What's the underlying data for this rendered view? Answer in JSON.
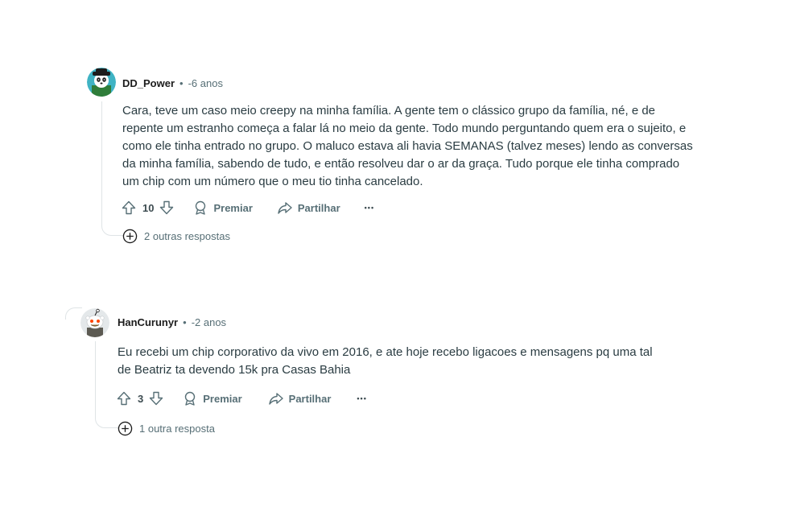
{
  "comments": [
    {
      "username": "DD_Power",
      "separator": "•",
      "time": "-6 anos",
      "avatar_icon": "panda-snoo-avatar",
      "text": "Cara, teve um caso meio creepy na minha família. A gente tem o clássico grupo da família, né, e de\nrepente um estranho começa a falar lá no meio da gente. Todo mundo perguntando quem era o sujeito, e\ncomo ele tinha entrado no grupo. O maluco estava ali havia SEMANAS (talvez meses) lendo as conversas\nda minha família, sabendo de tudo, e então resolveu dar o ar da graça. Tudo porque ele tinha comprado\num chip com um número que o meu tio tinha cancelado.",
      "votes": "10",
      "award_label": "Premiar",
      "share_label": "Partilhar",
      "more_label": "•••",
      "replies_label": "2 outras respostas"
    },
    {
      "username": "HanCurunyr",
      "separator": "•",
      "time": "-2 anos",
      "avatar_icon": "snoo-avatar",
      "text": "Eu recebi um chip corporativo da vivo em 2016, e ate hoje recebo ligacoes e mensagens pq uma tal\nde Beatriz ta devendo 15k pra Casas Bahia",
      "votes": "3",
      "award_label": "Premiar",
      "share_label": "Partilhar",
      "more_label": "•••",
      "replies_label": "1 outra resposta"
    }
  ],
  "colors": {
    "text": "#2a3c42",
    "meta": "#576f76",
    "thread": "#dfe4e6"
  }
}
